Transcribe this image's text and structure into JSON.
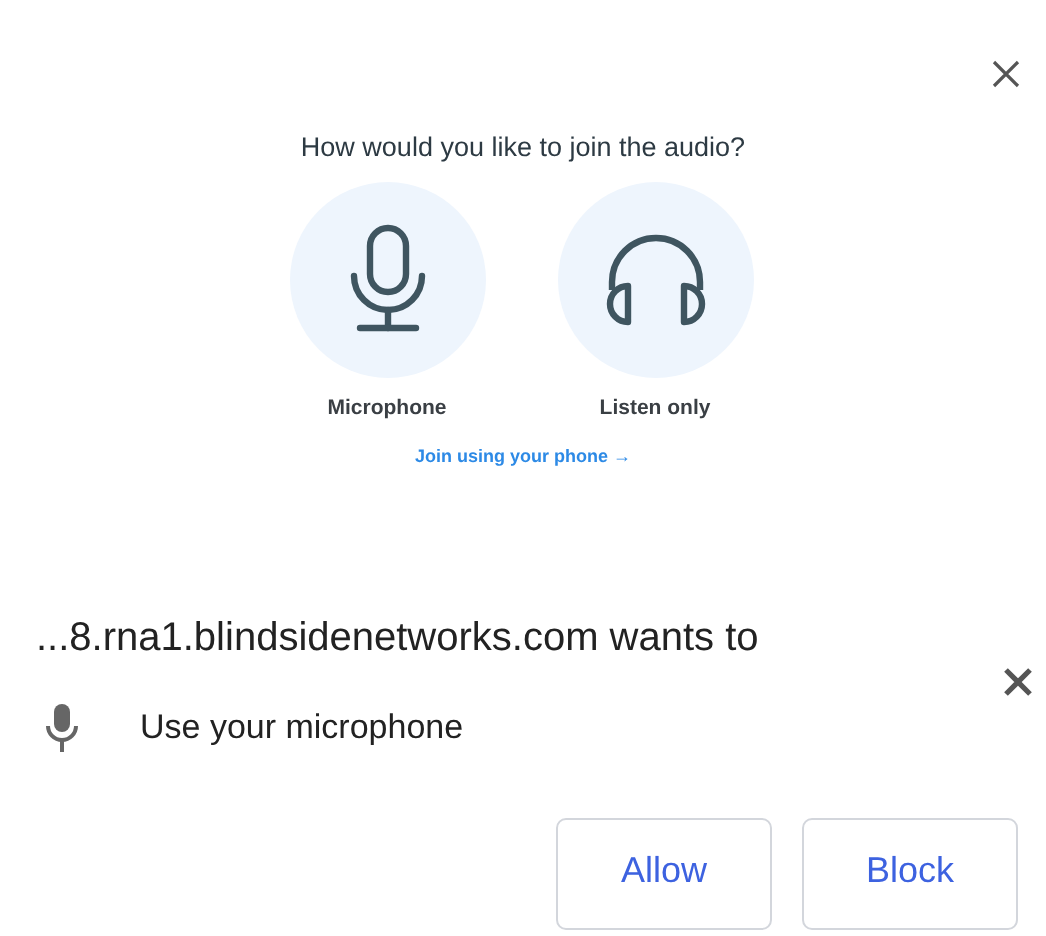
{
  "audio_modal": {
    "title": "How would you like to join the audio?",
    "options": [
      {
        "kind": "microphone",
        "label": "Microphone"
      },
      {
        "kind": "headphones",
        "label": "Listen only"
      }
    ],
    "phone_link": "Join using your phone →"
  },
  "permission_prompt": {
    "origin": "...8.rna1.blindsidenetworks.com wants to",
    "request": "Use your microphone",
    "buttons": [
      "Allow",
      "Block"
    ]
  }
}
